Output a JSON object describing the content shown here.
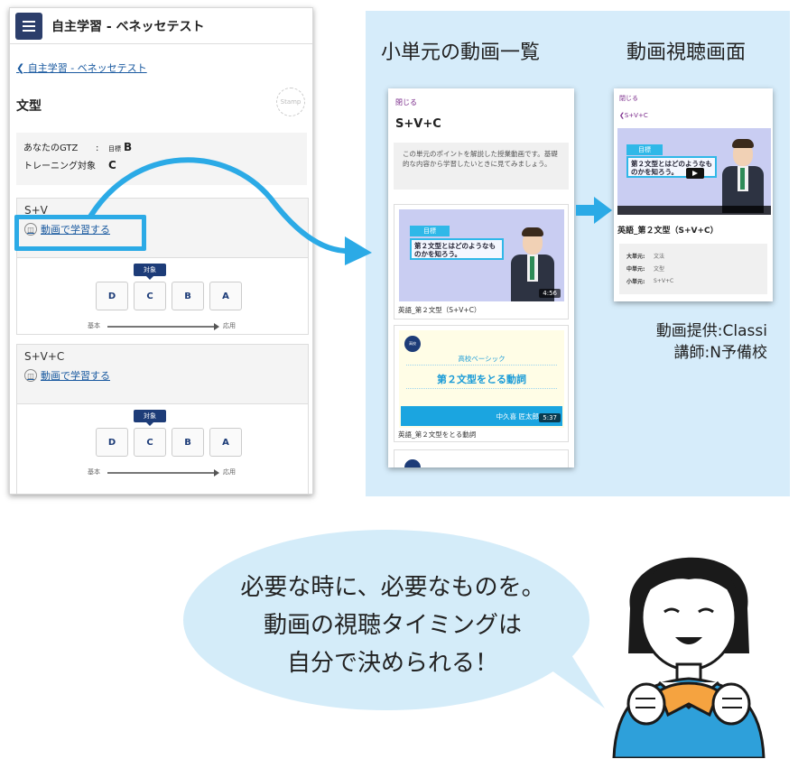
{
  "left_phone": {
    "header_title": "自主学習 - ベネッセテスト",
    "back_link": "自主学習 - ベネッセテスト",
    "section_title": "文型",
    "stamp": "Stamp",
    "info": {
      "gtz_label": "あなたのGTZ",
      "gtz_sep": ":",
      "gtz_target": "目標",
      "gtz_value": "B",
      "training_label": "トレーニング対象",
      "training_value": "C"
    },
    "units": [
      {
        "name": "S+V",
        "study_label": "動画で学習する"
      },
      {
        "name": "S+V+C",
        "study_label": "動画で学習する"
      }
    ],
    "target_tag": "対象",
    "grades": [
      "D",
      "C",
      "B",
      "A"
    ],
    "scale_start": "基本",
    "scale_end": "応用"
  },
  "panel": {
    "title_left": "小単元の動画一覧",
    "title_right": "動画視聴画面",
    "credit_line1": "動画提供:Classi",
    "credit_line2": "講師:N予備校"
  },
  "list_phone": {
    "close": "閉じる",
    "title": "S+V+C",
    "description": "この単元のポイントを解説した授業動画です。基礎的な内容から学習したいときに見てみましょう。",
    "video1": {
      "badge": "目標",
      "question": "第２文型とはどのようなものかを知ろう。",
      "duration": "4:56",
      "caption": "英語_第２文型（S+V+C）"
    },
    "video2": {
      "circle": "高校",
      "category": "高校ベーシック",
      "title": "第２文型をとる動詞",
      "teacher": "中久喜 匠太郎",
      "duration": "5:37",
      "caption": "英語_第２文型をとる動詞"
    }
  },
  "player_phone": {
    "close": "閉じる",
    "back": "S+V+C",
    "badge": "目標",
    "question": "第２文型とはどのようなものかを知ろう。",
    "title": "英語_第２文型（S+V+C）",
    "meta": [
      {
        "k": "大単元:",
        "v": "文法"
      },
      {
        "k": "中単元:",
        "v": "文型"
      },
      {
        "k": "小単元:",
        "v": "S+V+C"
      }
    ]
  },
  "speech": {
    "line1": "必要な時に、必要なものを。",
    "line2": "動画の視聴タイミングは",
    "line3": "自分で決められる！"
  },
  "colors": {
    "accent": "#2baae6",
    "navy": "#1d3c78",
    "panel_bg": "#d6ecfa",
    "bubble": "#d4ecf9"
  }
}
